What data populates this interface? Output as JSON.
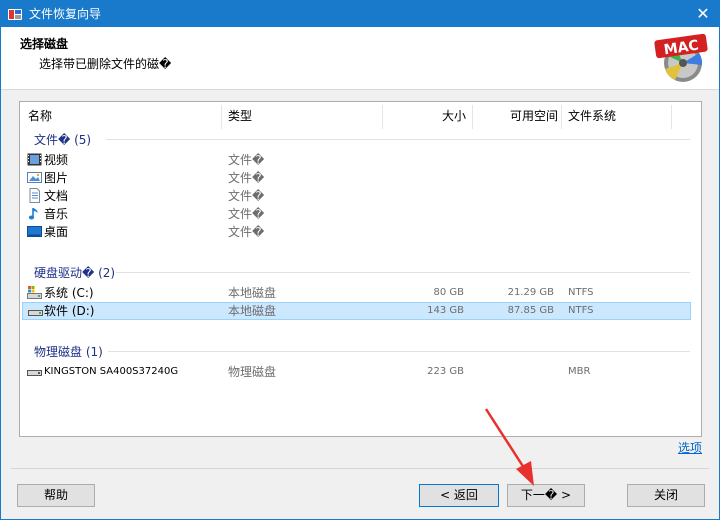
{
  "window": {
    "title": "文件恢复向导",
    "close_glyph": "✕"
  },
  "header": {
    "title": "选择磁盘",
    "subtitle": "选择带已删除文件的磁�",
    "logo_text": "MAC"
  },
  "columns": {
    "name": "名称",
    "type": "类型",
    "size": "大小",
    "free": "可用空间",
    "fs": "文件系统"
  },
  "groups": [
    {
      "label": "文件� (5)",
      "items": [
        {
          "name": "视频",
          "type": "文件�",
          "icon": "video-icon"
        },
        {
          "name": "图片",
          "type": "文件�",
          "icon": "picture-icon"
        },
        {
          "name": "文档",
          "type": "文件�",
          "icon": "document-icon"
        },
        {
          "name": "音乐",
          "type": "文件�",
          "icon": "music-icon"
        },
        {
          "name": "桌面",
          "type": "文件�",
          "icon": "desktop-icon"
        }
      ]
    },
    {
      "label": "硬盘驱动� (2)",
      "items": [
        {
          "name": "系统 (C:)",
          "type": "本地磁盘",
          "size": "80 GB",
          "free": "21.29 GB",
          "fs": "NTFS",
          "icon": "system-drive-icon"
        },
        {
          "name": "软件 (D:)",
          "type": "本地磁盘",
          "size": "143 GB",
          "free": "87.85 GB",
          "fs": "NTFS",
          "icon": "drive-icon",
          "selected": true
        }
      ]
    },
    {
      "label": "物理磁盘 (1)",
      "items": [
        {
          "name": "KINGSTON SA400S37240G",
          "type": "物理磁盘",
          "size": "223 GB",
          "free": "",
          "fs": "MBR",
          "icon": "physical-disk-icon"
        }
      ]
    }
  ],
  "footer": {
    "options_link": "选项",
    "help": "帮助",
    "back": "< 返回",
    "next": "下一� >",
    "close": "关闭"
  },
  "colors": {
    "titlebar": "#1979ca",
    "selection": "#cce8ff",
    "group_text": "#1e3287",
    "link": "#0066cc",
    "annotation_arrow": "#e8312f"
  }
}
